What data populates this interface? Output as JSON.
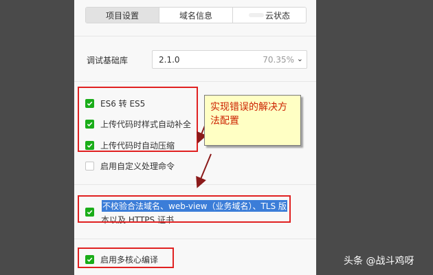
{
  "tabs": [
    {
      "label": "项目设置",
      "active": true
    },
    {
      "label": "域名信息",
      "active": false
    },
    {
      "label": "云状态",
      "active": false
    }
  ],
  "base_library": {
    "label": "调试基础库",
    "version": "2.1.0",
    "usage": "70.35%"
  },
  "options": [
    {
      "label": "ES6 转 ES5",
      "checked": true
    },
    {
      "label": "上传代码时样式自动补全",
      "checked": true
    },
    {
      "label": "上传代码时自动压缩",
      "checked": true
    },
    {
      "label": "启用自定义处理命令",
      "checked": false
    }
  ],
  "domain_check": {
    "line1": "不校验合法域名、web-view（业务域名）、TLS 版",
    "line2": "本以及 HTTPS 证书",
    "checked": true
  },
  "multicore": {
    "label": "启用多核心编译",
    "checked": true
  },
  "annotation": {
    "text": "实现错误的解决方法配置"
  },
  "watermark": {
    "text": "头条 @战斗鸡呀"
  },
  "colors": {
    "check_green": "#1aad19",
    "annotation_red": "#e02020",
    "note_bg": "#ffffc4",
    "highlight_blue": "#3b7dd8"
  }
}
